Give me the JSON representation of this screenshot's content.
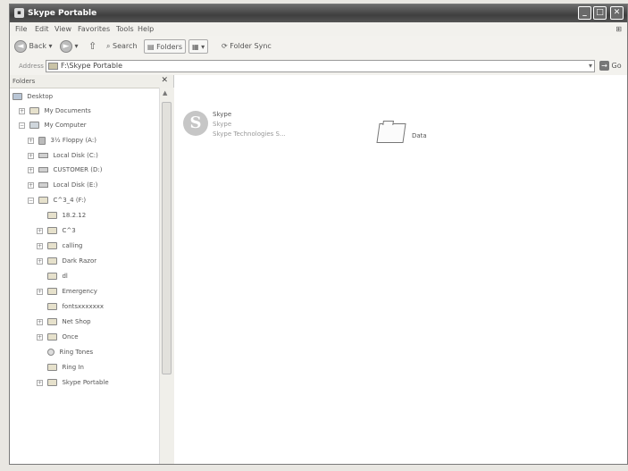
{
  "window": {
    "title": "Skype Portable"
  },
  "menu": [
    "File",
    "Edit",
    "View",
    "Favorites",
    "Tools",
    "Help"
  ],
  "toolbar": {
    "back": "Back",
    "search": "Search",
    "folders": "Folders",
    "folder_sync": "Folder Sync"
  },
  "address": {
    "label": "Address",
    "value": "F:\\Skype Portable",
    "go": "Go"
  },
  "folders_pane": {
    "header": "Folders",
    "tree": [
      {
        "label": "Desktop",
        "icon": "desktop-icon"
      },
      {
        "label": "My Documents",
        "icon": "folder-icon"
      },
      {
        "label": "My Computer",
        "icon": "computer-icon"
      },
      {
        "label": "3½ Floppy (A:)",
        "icon": "floppy-icon"
      },
      {
        "label": "Local Disk (C:)",
        "icon": "drive-icon"
      },
      {
        "label": "CUSTOMER (D:)",
        "icon": "drive-icon"
      },
      {
        "label": "Local Disk (E:)",
        "icon": "drive-icon"
      },
      {
        "label": "C^3_4 (F:)",
        "icon": "drive-icon"
      },
      {
        "label": "18.2.12",
        "icon": "folder-icon"
      },
      {
        "label": "C^3",
        "icon": "folder-icon"
      },
      {
        "label": "calling",
        "icon": "folder-icon"
      },
      {
        "label": "Dark Razor",
        "icon": "folder-icon"
      },
      {
        "label": "dl",
        "icon": "folder-icon"
      },
      {
        "label": "Emergency",
        "icon": "folder-icon"
      },
      {
        "label": "fontsxxxxxxx",
        "icon": "folder-icon"
      },
      {
        "label": "Net Shop",
        "icon": "folder-icon"
      },
      {
        "label": "Once",
        "icon": "folder-icon"
      },
      {
        "label": "Ring Tones",
        "icon": "music-icon"
      },
      {
        "label": "Ring In",
        "icon": "folder-icon"
      },
      {
        "label": "Skype Portable",
        "icon": "folder-icon"
      }
    ]
  },
  "content": {
    "items": [
      {
        "name": "Skype",
        "line2": "Skype",
        "line3": "Skype Technologies S...",
        "icon": "skype-icon"
      },
      {
        "name": "Data",
        "icon": "folder-icon"
      }
    ]
  }
}
